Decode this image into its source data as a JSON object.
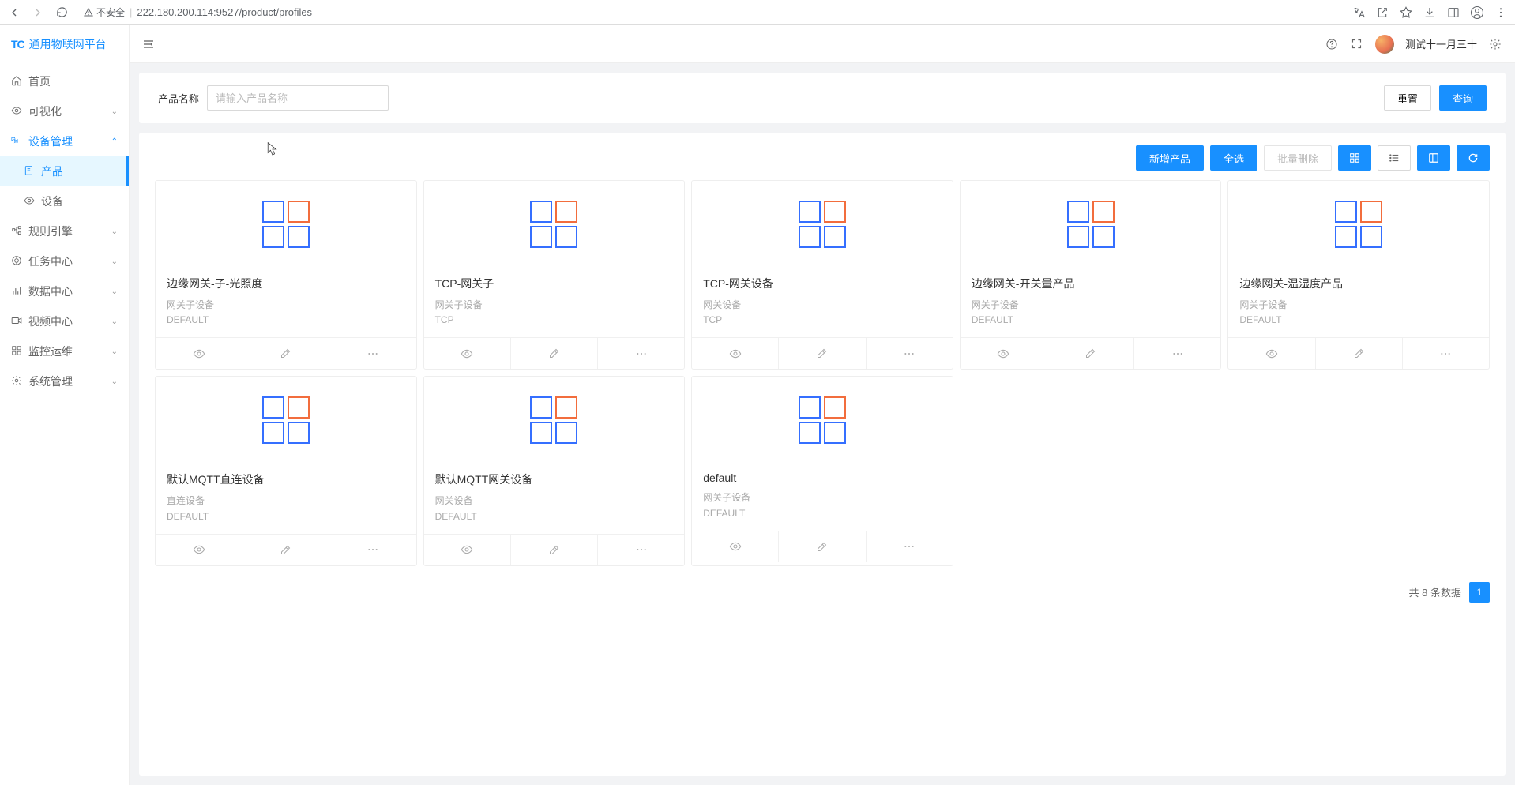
{
  "browser": {
    "url": "222.180.200.114:9527/product/profiles",
    "insecure_label": "不安全"
  },
  "brand": {
    "logo": "TC",
    "title": "通用物联网平台"
  },
  "sidebar": {
    "items": [
      {
        "label": "首页",
        "expandable": false
      },
      {
        "label": "可视化",
        "expandable": true
      },
      {
        "label": "设备管理",
        "expandable": true,
        "open": true
      },
      {
        "label": "产品",
        "sub": true,
        "active": true
      },
      {
        "label": "设备",
        "sub": true
      },
      {
        "label": "规则引擎",
        "expandable": true
      },
      {
        "label": "任务中心",
        "expandable": true
      },
      {
        "label": "数据中心",
        "expandable": true
      },
      {
        "label": "视频中心",
        "expandable": true
      },
      {
        "label": "监控运维",
        "expandable": true
      },
      {
        "label": "系统管理",
        "expandable": true
      }
    ]
  },
  "header": {
    "username": "测试十一月三十"
  },
  "filter": {
    "label": "产品名称",
    "placeholder": "请输入产品名称",
    "reset": "重置",
    "search": "查询"
  },
  "toolbar": {
    "add": "新增产品",
    "select_all": "全选",
    "batch_delete": "批量删除"
  },
  "products": [
    {
      "title": "边缘网关-子-光照度",
      "meta1": "网关子设备",
      "meta2": "DEFAULT"
    },
    {
      "title": "TCP-网关子",
      "meta1": "网关子设备",
      "meta2": "TCP"
    },
    {
      "title": "TCP-网关设备",
      "meta1": "网关设备",
      "meta2": "TCP"
    },
    {
      "title": "边缘网关-开关量产品",
      "meta1": "网关子设备",
      "meta2": "DEFAULT"
    },
    {
      "title": "边缘网关-温湿度产品",
      "meta1": "网关子设备",
      "meta2": "DEFAULT"
    },
    {
      "title": "默认MQTT直连设备",
      "meta1": "直连设备",
      "meta2": "DEFAULT"
    },
    {
      "title": "默认MQTT网关设备",
      "meta1": "网关设备",
      "meta2": "DEFAULT"
    },
    {
      "title": "default",
      "meta1": "网关子设备",
      "meta2": "DEFAULT"
    }
  ],
  "pager": {
    "total_label": "共 8 条数据",
    "current": "1"
  }
}
